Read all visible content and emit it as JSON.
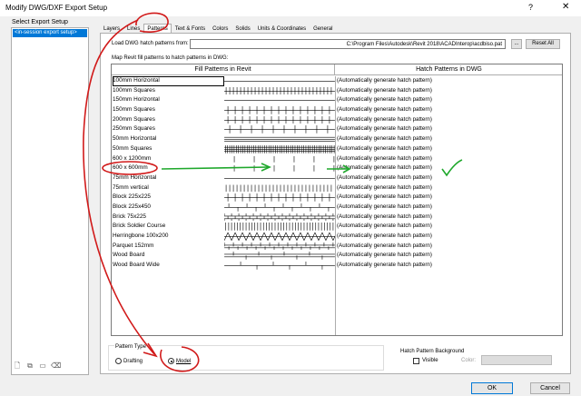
{
  "window": {
    "title": "Modify DWG/DXF Export Setup",
    "help": "?",
    "close": "✕"
  },
  "left": {
    "label": "Select Export Setup",
    "items": [
      "<in-session export setup>"
    ],
    "tools": [
      "new-icon",
      "duplicate-icon",
      "rename-icon",
      "delete-icon"
    ]
  },
  "tabs": [
    "Layers",
    "Lines",
    "Patterns",
    "Text & Fonts",
    "Colors",
    "Solids",
    "Units & Coordinates",
    "General"
  ],
  "active_tab": "Patterns",
  "patterns": {
    "load_label": "Load DWG hatch patterns from:",
    "path": "C:\\Program Files\\Autodesk\\Revit 2018\\ACADInterop\\acdbiso.pat",
    "browse": "...",
    "reset": "Reset All",
    "map_label": "Map Revit fill patterns to hatch patterns in DWG:",
    "col_fill": "Fill Patterns in Revit",
    "col_hatch": "Hatch Patterns in DWG",
    "rows": [
      {
        "name": "100mm Horizontal",
        "hatch": "(Automatically generate hatch pattern)",
        "pattern": "horizontal"
      },
      {
        "name": "100mm Squares",
        "hatch": "(Automatically generate hatch pattern)",
        "pattern": "grid-dense"
      },
      {
        "name": "150mm Horizontal",
        "hatch": "(Automatically generate hatch pattern)",
        "pattern": "horizontal"
      },
      {
        "name": "150mm Squares",
        "hatch": "(Automatically generate hatch pattern)",
        "pattern": "grid"
      },
      {
        "name": "200mm Squares",
        "hatch": "(Automatically generate hatch pattern)",
        "pattern": "grid"
      },
      {
        "name": "250mm Squares",
        "hatch": "(Automatically generate hatch pattern)",
        "pattern": "grid-sparse"
      },
      {
        "name": "50mm Horizontal",
        "hatch": "(Automatically generate hatch pattern)",
        "pattern": "horizontal-dense"
      },
      {
        "name": "50mm Squares",
        "hatch": "(Automatically generate hatch pattern)",
        "pattern": "grid-very-dense"
      },
      {
        "name": "600 x 1200mm",
        "hatch": "(Automatically generate hatch pattern)",
        "pattern": "sparse-vertical"
      },
      {
        "name": "600 x 600mm",
        "hatch": "(Automatically generate hatch pattern)",
        "pattern": "sparse-vertical"
      },
      {
        "name": "75mm Horizontal",
        "hatch": "(Automatically generate hatch pattern)",
        "pattern": "horizontal"
      },
      {
        "name": "75mm vertical",
        "hatch": "(Automatically generate hatch pattern)",
        "pattern": "vertical"
      },
      {
        "name": "Block 225x225",
        "hatch": "(Automatically generate hatch pattern)",
        "pattern": "grid"
      },
      {
        "name": "Block 225x450",
        "hatch": "(Automatically generate hatch pattern)",
        "pattern": "brick-sparse"
      },
      {
        "name": "Brick 75x225",
        "hatch": "(Automatically generate hatch pattern)",
        "pattern": "brick"
      },
      {
        "name": "Brick Soldier Course",
        "hatch": "(Automatically generate hatch pattern)",
        "pattern": "vertical-dense"
      },
      {
        "name": "Herringbone 100x200",
        "hatch": "(Automatically generate hatch pattern)",
        "pattern": "herringbone"
      },
      {
        "name": "Parquet 152mm",
        "hatch": "(Automatically generate hatch pattern)",
        "pattern": "parquet"
      },
      {
        "name": "Wood Board",
        "hatch": "(Automatically generate hatch pattern)",
        "pattern": "board"
      },
      {
        "name": "Wood Board Wide",
        "hatch": "(Automatically generate hatch pattern)",
        "pattern": "board-wide"
      }
    ]
  },
  "pattern_type": {
    "label": "Pattern Type",
    "options": [
      "Drafting",
      "Model"
    ],
    "selected": "Model"
  },
  "hatch_bg": {
    "label": "Hatch Pattern Background",
    "visible_label": "Visible",
    "visible_checked": false,
    "color_label": "Color:"
  },
  "buttons": {
    "ok": "OK",
    "cancel": "Cancel"
  },
  "annotation_color": "#d11a1a",
  "annotation_green": "#1fa82c"
}
